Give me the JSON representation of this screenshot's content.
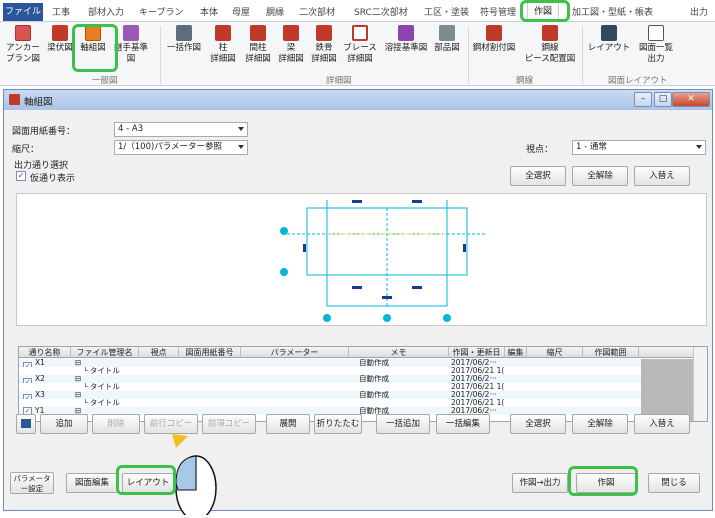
{
  "ribbon": {
    "tabs": [
      "ファイル",
      "工事",
      "部材入力",
      "キープラン",
      "本体",
      "母屋",
      "胴縁",
      "二次部材",
      "SRC二次部材",
      "工区・塗装",
      "符号管理",
      "作図",
      "加工図・型紙・帳表",
      "出力"
    ],
    "buttons": {
      "anchor_plan": "アンカー\nプラン図",
      "beam_plan": "梁伏図",
      "axis_drawing": "軸組図",
      "joint_standard": "継手基準図",
      "batch_draw": "一括作図",
      "column_detail": "柱\n詳細図",
      "stud_detail": "間柱\n詳細図",
      "beam_detail": "梁\n詳細図",
      "rebar_detail": "鉄骨\n詳細図",
      "brace_detail": "ブレース\n詳細図",
      "weld_standard": "溶接基準図",
      "parts_diagram": "部品図",
      "steel_allocation": "鋼材割付図",
      "piece_layout": "鋼線\nピース配置図",
      "layout": "レイアウト",
      "drawing_list_output": "図面一覧\n出力"
    },
    "groups": [
      "一般図",
      "詳細図",
      "鋼線",
      "図面レイアウト"
    ]
  },
  "dialog": {
    "title": "軸組図",
    "paper_label": "図面用紙番号：",
    "paper_value": "4 - A3",
    "scale_label": "縮尺：",
    "scale_value": "1/（100)パラメーター参照",
    "viewpoint_label": "視点：",
    "viewpoint_value": "1 - 通常",
    "output_select_label": "出力通り選択",
    "virtual_display_label": "仮通り表示",
    "virtual_display_checked": "✓",
    "top_buttons": {
      "select_all": "全選択",
      "deselect_all": "全解除",
      "swap": "入替え"
    },
    "grid": {
      "columns": [
        "通り名称",
        "ファイル管理名",
        "視点",
        "図面用紙番号",
        "パラメーター",
        "メモ",
        "作図・更新日時",
        "編集",
        "縮尺",
        "作図範囲"
      ],
      "rows": [
        {
          "name": "X1",
          "file": "⊟",
          "memo": "自動作成",
          "date": "2017/06/2···",
          "checked": "✓"
        },
        {
          "name": "",
          "file": "└ タイトル",
          "memo": "",
          "date": "2017/06/21 1(",
          "checked": ""
        },
        {
          "name": "X2",
          "file": "⊟",
          "memo": "自動作成",
          "date": "2017/06/2···",
          "checked": "✓"
        },
        {
          "name": "",
          "file": "└ タイトル",
          "memo": "",
          "date": "2017/06/21 1(",
          "checked": ""
        },
        {
          "name": "X3",
          "file": "⊟",
          "memo": "自動作成",
          "date": "2017/06/2···",
          "checked": "✓"
        },
        {
          "name": "",
          "file": "└ タイトル",
          "memo": "",
          "date": "2017/06/21 1(",
          "checked": ""
        },
        {
          "name": "Y1",
          "file": "⊟",
          "memo": "自動作成",
          "date": "2017/06/2···",
          "checked": "✓"
        }
      ]
    },
    "row_buttons": {
      "add": "追加",
      "delete": "削除",
      "prev_copy": "前行コピー",
      "prev_ref_copy": "前項コピー",
      "expand": "展開",
      "collapse": "折りたたむ",
      "batch_add": "一括追加",
      "batch_edit": "一括編集",
      "select_all": "全選択",
      "deselect_all": "全解除",
      "swap": "入替え"
    },
    "bottom_buttons": {
      "param_settings": "パラメーター設定",
      "drawing_edit": "図面編集",
      "layout": "レイアウト",
      "draw_output": "作図→出力",
      "draw": "作図",
      "close": "閉じる"
    }
  },
  "colors": {
    "highlight": "#3cc24a",
    "accent": "#2b579a",
    "preview_line": "#00b7d8"
  }
}
